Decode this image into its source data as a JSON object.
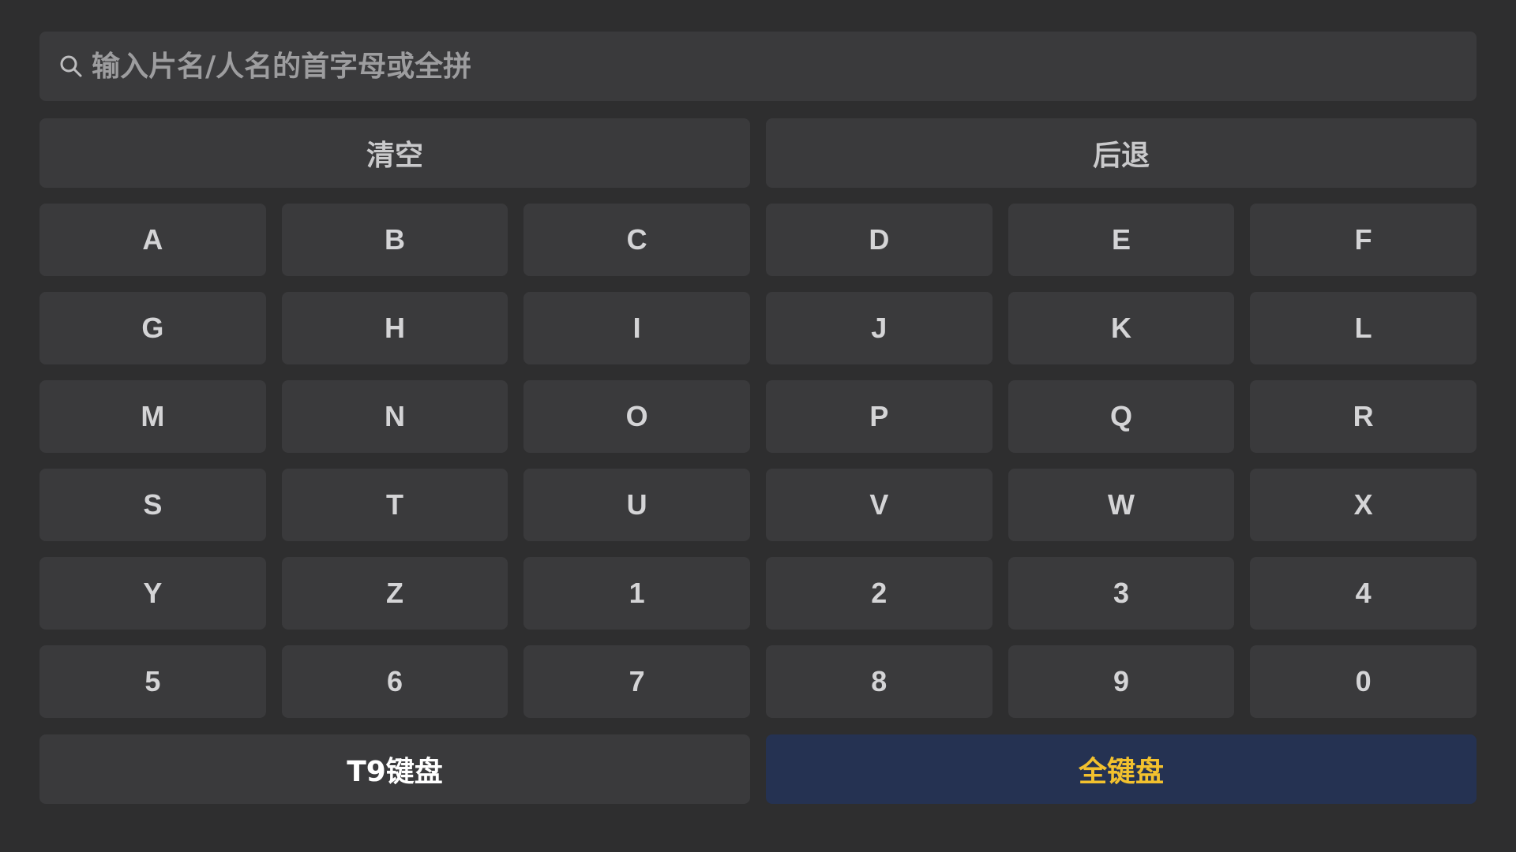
{
  "search": {
    "placeholder": "输入片名/人名的首字母或全拼",
    "value": "",
    "icon": "search-icon"
  },
  "actions": {
    "clear_label": "清空",
    "backspace_label": "后退"
  },
  "keys": [
    "A",
    "B",
    "C",
    "D",
    "E",
    "F",
    "G",
    "H",
    "I",
    "J",
    "K",
    "L",
    "M",
    "N",
    "O",
    "P",
    "Q",
    "R",
    "S",
    "T",
    "U",
    "V",
    "W",
    "X",
    "Y",
    "Z",
    "1",
    "2",
    "3",
    "4",
    "5",
    "6",
    "7",
    "8",
    "9",
    "0"
  ],
  "modes": {
    "t9_label": "T9键盘",
    "full_label": "全键盘",
    "selected": "全键盘"
  },
  "colors": {
    "background": "#2e2e2f",
    "key": "#3a3a3c",
    "active_mode_bg": "#253252",
    "active_mode_text": "#f2c12e"
  }
}
